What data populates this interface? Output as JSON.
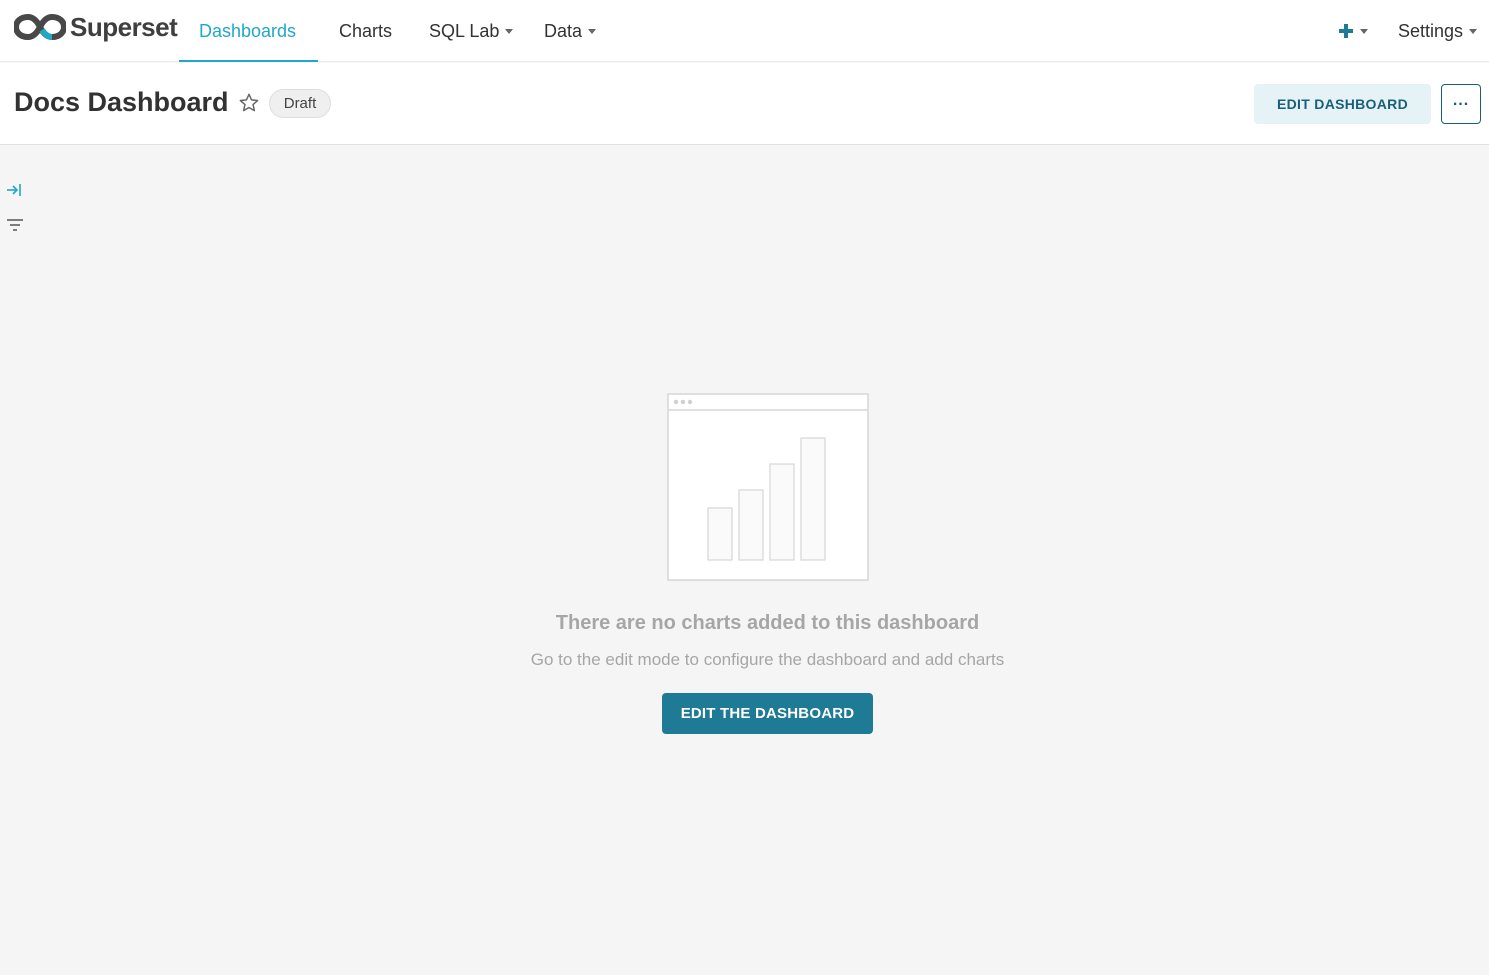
{
  "navbar": {
    "brand": "Superset",
    "items": [
      {
        "label": "Dashboards",
        "active": true
      },
      {
        "label": "Charts",
        "active": false
      },
      {
        "label": "SQL Lab",
        "active": false,
        "dropdown": true
      },
      {
        "label": "Data",
        "active": false,
        "dropdown": true
      }
    ],
    "settings_label": "Settings",
    "plus_icon": "plus-icon"
  },
  "header": {
    "title": "Docs Dashboard",
    "status_badge": "Draft",
    "edit_button": "EDIT DASHBOARD",
    "more_icon": "more-dots-icon"
  },
  "sidebar": {
    "expand_icon": "expand-arrow-icon",
    "filter_icon": "filter-icon"
  },
  "empty_state": {
    "title": "There are no charts added to this dashboard",
    "description": "Go to the edit mode to configure the dashboard and add charts",
    "button": "EDIT THE DASHBOARD"
  },
  "colors": {
    "accent": "#20a7c9",
    "primary_dark": "#1f7a96",
    "edit_bg": "#e5f3f7"
  }
}
